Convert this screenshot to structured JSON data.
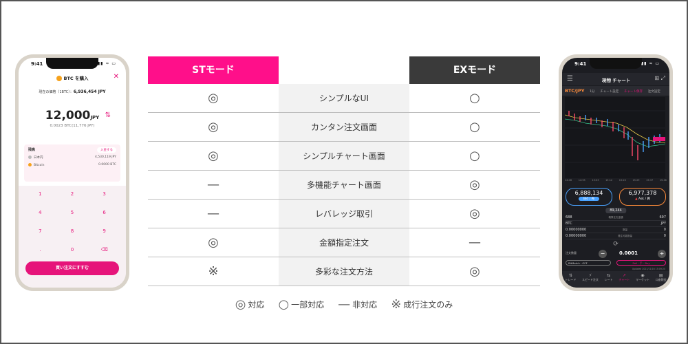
{
  "table": {
    "headers": {
      "st": "STモード",
      "middle": "",
      "ex": "EXモード"
    },
    "rows": [
      {
        "st": "◎",
        "feature": "シンプルなUI",
        "ex": "○"
      },
      {
        "st": "◎",
        "feature": "カンタン注文画面",
        "ex": "○"
      },
      {
        "st": "◎",
        "feature": "シンプルチャート画面",
        "ex": "○"
      },
      {
        "st": "—",
        "feature": "多機能チャート画面",
        "ex": "◎"
      },
      {
        "st": "—",
        "feature": "レバレッジ取引",
        "ex": "◎"
      },
      {
        "st": "◎",
        "feature": "金額指定注文",
        "ex": "—"
      },
      {
        "st": "※",
        "feature": "多彩な注文方法",
        "ex": "◎"
      }
    ]
  },
  "legend": [
    {
      "symbol": "◎",
      "label": "対応"
    },
    {
      "symbol": "○",
      "label": "一部対応"
    },
    {
      "symbol": "—",
      "label": "非対応"
    },
    {
      "symbol": "※",
      "label": "成行注文のみ"
    }
  ],
  "left_phone": {
    "time": "9:41",
    "status": "▮▮ ≈ ▭",
    "title": "BTC を購入",
    "close": "✕",
    "rate_label": "現在の価格（1BTC）：",
    "rate_value": "6,936,454 JPY",
    "amount": "12,000",
    "amount_unit": "JPY",
    "swap_icon": "⇅",
    "sub": "0.0023 BTC(11,776 JPY)",
    "balance_title": "残高",
    "deposit": "入金する",
    "jpy_label": "日本円",
    "jpy_value": "4,530,119 JPY",
    "btc_label": "Bitcoin",
    "btc_value": "0.0000 BTC",
    "keys": [
      "1",
      "2",
      "3",
      "4",
      "5",
      "6",
      "7",
      "8",
      "9",
      ".",
      "0",
      "⌫"
    ],
    "button": "買い注文にすすむ"
  },
  "right_phone": {
    "time": "9:41",
    "status": "▮▮ ≈ ▭",
    "title": "現物 チャート",
    "pair": "BTC/JPY",
    "tabs": [
      "1分",
      "チャート設定",
      "チャート保存",
      "注文設定"
    ],
    "ticks": [
      "14:46",
      "14:55",
      "15:03",
      "15:12",
      "15:20",
      "15:29",
      "15:37",
      "15:46"
    ],
    "bid_value": "6,888,134",
    "bid_label": "Bid / 売",
    "ask_value": "6,977,378",
    "ask_label": "Ask / 買",
    "spread": "89,244",
    "row1": [
      "688",
      "概算注文金額",
      "697"
    ],
    "row2": [
      "BTC",
      "",
      "JPY"
    ],
    "row3": [
      "0.00000000",
      "数量",
      "0"
    ],
    "row4": [
      "0.00000000",
      "発注可能数量",
      "0"
    ],
    "qty_label": "注文数量",
    "qty_value": "0.0001",
    "bitmatch": "BitMatch : OFF",
    "market": "Sell · 手 · Buy",
    "updated": "Updated 2021/11/16 15:09:20",
    "nav": [
      {
        "icon": "⇅",
        "label": "トレード"
      },
      {
        "icon": "⚡",
        "label": "スピード注文"
      },
      {
        "icon": "⇆",
        "label": "レート"
      },
      {
        "icon": "↗",
        "label": "チャート"
      },
      {
        "icon": "◉",
        "label": "マーケット"
      },
      {
        "icon": "▤",
        "label": "口座照会"
      }
    ]
  }
}
